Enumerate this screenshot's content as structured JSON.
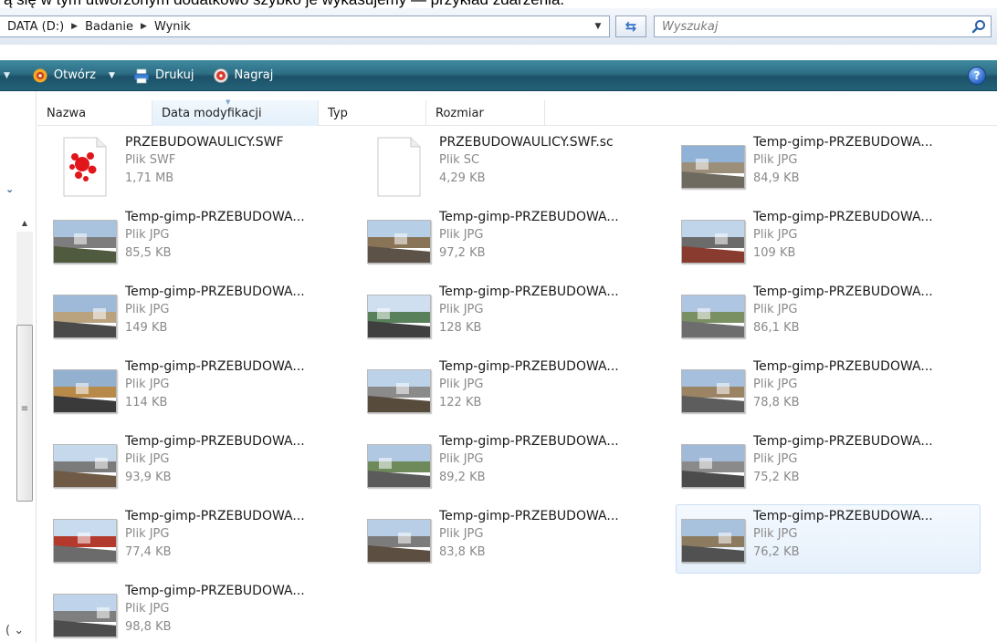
{
  "top_text": "ą się w tym utworzonym dodatkowo szybko je wykasujemy — przykład zdarzenia.",
  "address": {
    "segments": [
      "DATA (D:)",
      "Badanie",
      "Wynik"
    ],
    "search_placeholder": "Wyszukaj"
  },
  "toolbar": {
    "open_label": "Otwórz",
    "print_label": "Drukuj",
    "burn_label": "Nagraj",
    "help_label": "?"
  },
  "columns": [
    "Nazwa",
    "Data modyfikacji",
    "Typ",
    "Rozmiar"
  ],
  "files": [
    {
      "name": "PRZEBUDOWAULICY.SWF",
      "type": "Plik SWF",
      "size": "1,71 MB",
      "icon": "flash-file-icon"
    },
    {
      "name": "PRZEBUDOWAULICY.SWF.sc",
      "type": "Plik SC",
      "size": "4,29 KB",
      "icon": "blank-document-icon"
    },
    {
      "name": "Temp-gimp-PRZEBUDOWA...",
      "type": "Plik JPG",
      "size": "84,9 KB",
      "icon": "photo-thumbnail"
    },
    {
      "name": "Temp-gimp-PRZEBUDOWA...",
      "type": "Plik JPG",
      "size": "85,5 KB",
      "icon": "photo-thumbnail"
    },
    {
      "name": "Temp-gimp-PRZEBUDOWA...",
      "type": "Plik JPG",
      "size": "97,2 KB",
      "icon": "photo-thumbnail"
    },
    {
      "name": "Temp-gimp-PRZEBUDOWA...",
      "type": "Plik JPG",
      "size": "109 KB",
      "icon": "photo-thumbnail"
    },
    {
      "name": "Temp-gimp-PRZEBUDOWA...",
      "type": "Plik JPG",
      "size": "149 KB",
      "icon": "photo-thumbnail"
    },
    {
      "name": "Temp-gimp-PRZEBUDOWA...",
      "type": "Plik JPG",
      "size": "128 KB",
      "icon": "photo-thumbnail"
    },
    {
      "name": "Temp-gimp-PRZEBUDOWA...",
      "type": "Plik JPG",
      "size": "86,1 KB",
      "icon": "photo-thumbnail"
    },
    {
      "name": "Temp-gimp-PRZEBUDOWA...",
      "type": "Plik JPG",
      "size": "114 KB",
      "icon": "photo-thumbnail"
    },
    {
      "name": "Temp-gimp-PRZEBUDOWA...",
      "type": "Plik JPG",
      "size": "122 KB",
      "icon": "photo-thumbnail"
    },
    {
      "name": "Temp-gimp-PRZEBUDOWA...",
      "type": "Plik JPG",
      "size": "78,8 KB",
      "icon": "photo-thumbnail"
    },
    {
      "name": "Temp-gimp-PRZEBUDOWA...",
      "type": "Plik JPG",
      "size": "93,9 KB",
      "icon": "photo-thumbnail"
    },
    {
      "name": "Temp-gimp-PRZEBUDOWA...",
      "type": "Plik JPG",
      "size": "89,2 KB",
      "icon": "photo-thumbnail"
    },
    {
      "name": "Temp-gimp-PRZEBUDOWA...",
      "type": "Plik JPG",
      "size": "75,2 KB",
      "icon": "photo-thumbnail"
    },
    {
      "name": "Temp-gimp-PRZEBUDOWA...",
      "type": "Plik JPG",
      "size": "77,4 KB",
      "icon": "photo-thumbnail"
    },
    {
      "name": "Temp-gimp-PRZEBUDOWA...",
      "type": "Plik JPG",
      "size": "83,8 KB",
      "icon": "photo-thumbnail",
      "selected": false
    },
    {
      "name": "Temp-gimp-PRZEBUDOWA...",
      "type": "Plik JPG",
      "size": "76,2 KB",
      "icon": "photo-thumbnail",
      "selected": true
    },
    {
      "name": "Temp-gimp-PRZEBUDOWA...",
      "type": "Plik JPG",
      "size": "98,8 KB",
      "icon": "photo-thumbnail"
    }
  ],
  "colors": {
    "toolbar": "#2d6d84",
    "selection": "#e6f0fb",
    "secondary_text": "#8a8a8a"
  }
}
